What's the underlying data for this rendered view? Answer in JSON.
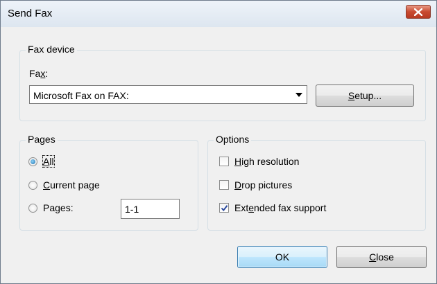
{
  "window": {
    "title": "Send Fax"
  },
  "fax_device": {
    "group_label": "Fax device",
    "fax_label_pre": "Fa",
    "fax_label_u": "x",
    "fax_label_post": ":",
    "selected_fax": "Microsoft Fax on FAX:",
    "setup_pre": "",
    "setup_u": "S",
    "setup_post": "etup..."
  },
  "pages": {
    "group_label": "Pages",
    "options": [
      {
        "u": "A",
        "rest": "ll",
        "checked": true
      },
      {
        "u": "C",
        "rest": "urrent page",
        "checked": false
      },
      {
        "pre": "Pages:",
        "checked": false
      }
    ],
    "range_value": "1-1"
  },
  "options": {
    "group_label": "Options",
    "items": [
      {
        "pre": "",
        "u": "H",
        "post": "igh resolution",
        "checked": false
      },
      {
        "pre": "",
        "u": "D",
        "post": "rop pictures",
        "checked": false
      },
      {
        "pre": "Ext",
        "u": "e",
        "post": "nded fax support",
        "checked": true
      }
    ]
  },
  "buttons": {
    "ok": "OK",
    "close_u": "C",
    "close_rest": "lose"
  }
}
